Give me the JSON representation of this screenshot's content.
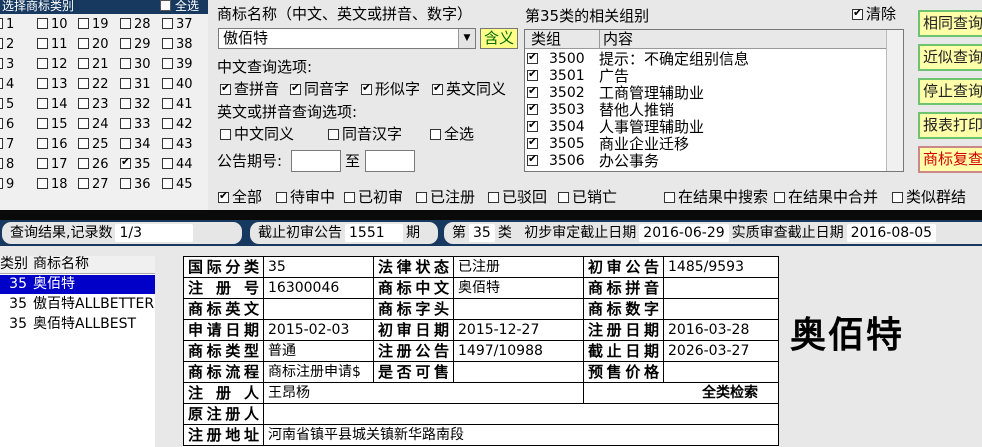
{
  "category_panel": {
    "title": "选择商标类别",
    "all_label": "全选",
    "numbers": [
      1,
      2,
      3,
      4,
      5,
      6,
      7,
      8,
      9,
      10,
      11,
      12,
      13,
      14,
      15,
      16,
      17,
      18,
      19,
      20,
      21,
      22,
      23,
      24,
      25,
      26,
      27,
      28,
      29,
      30,
      31,
      32,
      33,
      34,
      35,
      36,
      37,
      38,
      39,
      40,
      41,
      42,
      43,
      44,
      45
    ],
    "checked": [
      35
    ]
  },
  "search": {
    "name_label": "商标名称（中文、英文或拼音、数字）",
    "name_value": "傲佰特",
    "include_btn": "含义",
    "cn_options_label": "中文查询选项:",
    "cn_options": [
      "查拼音",
      "同音字",
      "形似字",
      "英文同义"
    ],
    "en_options_label": "英文或拼音查询选项:",
    "en_options": [
      "中文同义",
      "同音汉字",
      "全选"
    ],
    "gazette_label": "公告期号:",
    "to_label": "至"
  },
  "groups": {
    "title": "第35类的相关组别",
    "clear_label": "清除",
    "col_group": "类组",
    "col_content": "内容",
    "rows": [
      {
        "code": "3500",
        "desc": "提示：不确定组别信息"
      },
      {
        "code": "3501",
        "desc": "广告"
      },
      {
        "code": "3502",
        "desc": "工商管理辅助业"
      },
      {
        "code": "3503",
        "desc": "替他人推销"
      },
      {
        "code": "3504",
        "desc": "人事管理辅助业"
      },
      {
        "code": "3505",
        "desc": "商业企业迁移"
      },
      {
        "code": "3506",
        "desc": "办公事务"
      }
    ]
  },
  "right_buttons": [
    "相同查询",
    "近似查询",
    "停止查询",
    "报表打印",
    "商标复查"
  ],
  "filters": [
    "全部",
    "待审中",
    "已初审",
    "已注册",
    "已驳回",
    "已销亡",
    "在结果中搜索",
    "在结果中合并",
    "类似群结"
  ],
  "status": {
    "result_label": "查询结果,记录数",
    "result_value": "1/3",
    "deadline_label": "截止初审公告",
    "deadline_value": "1551",
    "period_label": "期",
    "class_prefix": "第",
    "class_value": "35",
    "class_suffix": "类",
    "initial_label": "初步审定截止日期",
    "initial_value": "2016-06-29",
    "exam_label": "实质审查截止日期",
    "exam_value": "2016-08-05"
  },
  "result_list": {
    "col_class": "类别",
    "col_name": "商标名称",
    "rows": [
      {
        "cls": "35",
        "name": "奥佰特"
      },
      {
        "cls": "35",
        "name": "傲百特ALLBETTER"
      },
      {
        "cls": "35",
        "name": "奥佰特ALLBEST"
      }
    ]
  },
  "detail": {
    "intl_class_label": "国际分类",
    "intl_class": "35",
    "legal_status_label": "法律状态",
    "legal_status": "已注册",
    "prelim_pub_label": "初审公告",
    "prelim_pub": "1485/9593",
    "reg_no_label": "注 册 号",
    "reg_no": "16300046",
    "cn_name_label": "商标中文",
    "cn_name": "奥佰特",
    "pinyin_label": "商标拼音",
    "pinyin": "",
    "en_name_label": "商标英文",
    "en_name": "",
    "initial_label": "商标字头",
    "initial": "",
    "digits_label": "商标数字",
    "digits": "",
    "apply_date_label": "申请日期",
    "apply_date": "2015-02-03",
    "prelim_date_label": "初审日期",
    "prelim_date": "2015-12-27",
    "reg_date_label": "注册日期",
    "reg_date": "2016-03-28",
    "type_label": "商标类型",
    "type": "普通",
    "reg_pub_label": "注册公告",
    "reg_pub": "1497/10988",
    "expiry_label": "截止日期",
    "expiry": "2026-03-27",
    "flow_label": "商标流程",
    "flow": "商标注册申请$",
    "shared_label": "是否可售",
    "shared": "",
    "presale_label": "预售价格",
    "presale": "",
    "registrant_label": "注 册 人",
    "registrant": "王昂杨",
    "all_search_label": "全类检索",
    "orig_registrant_label": "原注册人",
    "orig_registrant": "",
    "address_label": "注册地址",
    "address": "河南省镇平县城关镇新华路南段"
  },
  "brand_preview": "奥佰特"
}
